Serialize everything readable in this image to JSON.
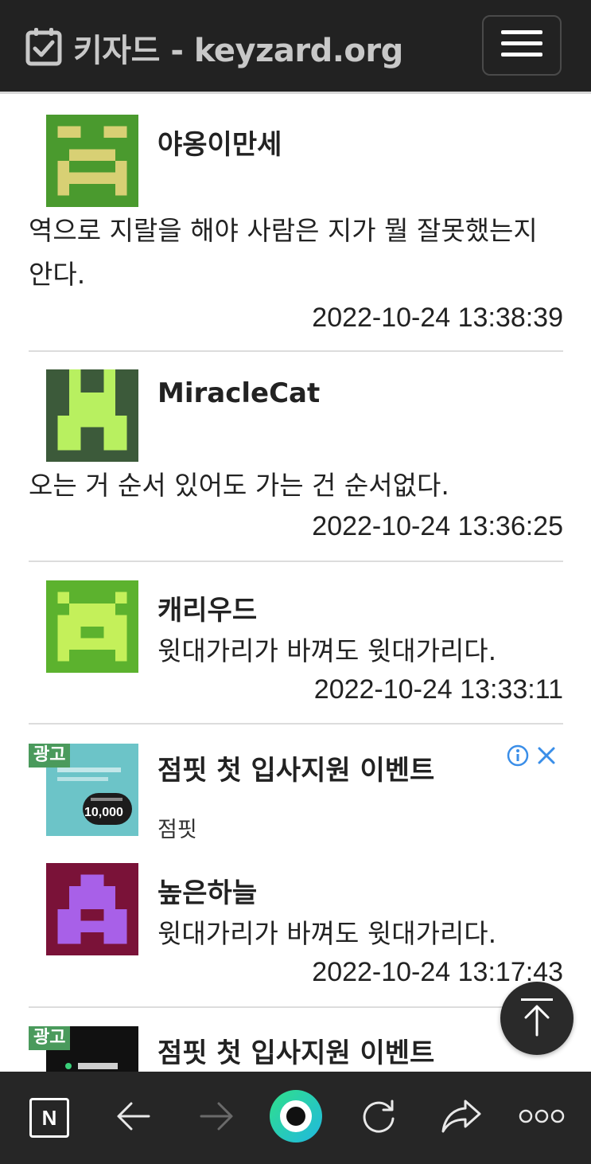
{
  "header": {
    "title": "키자드 - keyzard.org",
    "logo_icon": "calendar-check-icon",
    "menu_icon": "hamburger-menu-icon"
  },
  "comments": [
    {
      "nickname": "야옹이만세",
      "text": "역으로 지랄을 해야 사람은 지가 뭘 잘못했는지 안다.",
      "date": "2022-10-24 13:38:39",
      "avatar_colors": {
        "bg": "#4a9a2e",
        "fg": "#d8d074"
      }
    },
    {
      "nickname": "MiracleCat",
      "text": "오는 거 순서 있어도 가는 건 순서없다.",
      "date": "2022-10-24 13:36:25",
      "avatar_colors": {
        "bg": "#3c5a3a",
        "fg": "#b8f060"
      }
    },
    {
      "nickname": "캐리우드",
      "text": "윗대가리가 바껴도 윗대가리다.",
      "date": "2022-10-24 13:33:11",
      "avatar_colors": {
        "bg": "#5cb22e",
        "fg": "#c4f05a"
      }
    },
    {
      "nickname": "높은하늘",
      "text": "윗대가리가 바껴도 윗대가리다.",
      "date": "2022-10-24 13:17:43",
      "avatar_colors": {
        "bg": "#7a1238",
        "fg": "#a860e8"
      }
    }
  ],
  "ads": [
    {
      "badge": "광고",
      "title": "점핏 첫 입사지원 이벤트",
      "source": "점핏",
      "thumb_text": "10,000",
      "thumb_color": "#6cc4c8"
    },
    {
      "badge": "광고",
      "title": "점핏 첫 입사지원 이벤트",
      "thumb_color": "#111111"
    }
  ],
  "bottom_nav": [
    {
      "name": "naver-home-icon",
      "label": "N"
    },
    {
      "name": "back-arrow-icon"
    },
    {
      "name": "forward-arrow-icon"
    },
    {
      "name": "green-dot-icon"
    },
    {
      "name": "refresh-icon"
    },
    {
      "name": "share-icon"
    },
    {
      "name": "more-icon"
    }
  ],
  "colors": {
    "header_bg": "#222222",
    "bottombar_bg": "#262626",
    "ad_badge": "#4a9a5c",
    "ad_info": "#3a8ee8"
  }
}
